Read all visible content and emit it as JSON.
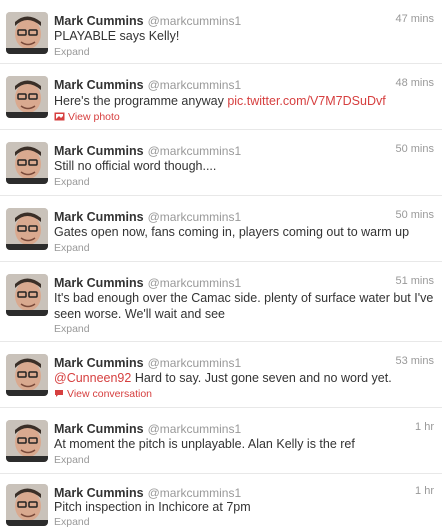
{
  "tweets": [
    {
      "name": "Mark Cummins",
      "handle": "@markcummins1",
      "time": "47 mins",
      "text": "PLAYABLE says Kelly!",
      "action": "Expand",
      "action_icon": "none"
    },
    {
      "name": "Mark Cummins",
      "handle": "@markcummins1",
      "time": "48 mins",
      "text": "Here's the programme anyway",
      "link": "pic.twitter.com/V7M7DSuDvf",
      "action": "View photo",
      "action_icon": "photo-icon"
    },
    {
      "name": "Mark Cummins",
      "handle": "@markcummins1",
      "time": "50 mins",
      "text": "Still no official word though....",
      "action": "Expand",
      "action_icon": "none"
    },
    {
      "name": "Mark Cummins",
      "handle": "@markcummins1",
      "time": "50 mins",
      "text": "Gates open now, fans coming in, players coming out to warm up",
      "action": "Expand",
      "action_icon": "none"
    },
    {
      "name": "Mark Cummins",
      "handle": "@markcummins1",
      "time": "51 mins",
      "text_line1": "It's bad enough over the Camac side. plenty of surface water but I've",
      "text_line2": "seen worse. We'll wait and see",
      "action": "Expand",
      "action_icon": "none"
    },
    {
      "name": "Mark Cummins",
      "handle": "@markcummins1",
      "time": "53 mins",
      "mention": "@Cunneen92",
      "text": " Hard to say. Just gone seven and no word yet.",
      "action": "View conversation",
      "action_icon": "conversation-icon"
    },
    {
      "name": "Mark Cummins",
      "handle": "@markcummins1",
      "time": "1 hr",
      "text": "At moment the pitch is unplayable. Alan Kelly is the ref",
      "action": "Expand",
      "action_icon": "none"
    },
    {
      "name": "Mark Cummins",
      "handle": "@markcummins1",
      "time": "1 hr",
      "text": "Pitch inspection in Inchicore at 7pm",
      "action": "Expand",
      "action_icon": "none"
    }
  ],
  "colors": {
    "link": "#d63f3f",
    "meta": "#999999",
    "text": "#333333"
  }
}
